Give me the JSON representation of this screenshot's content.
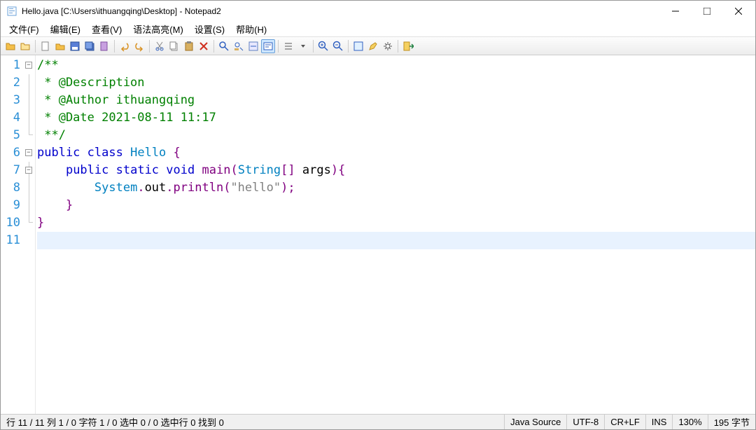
{
  "window": {
    "title": "Hello.java [C:\\Users\\ithuangqing\\Desktop] - Notepad2"
  },
  "menu": {
    "file": "文件(F)",
    "edit": "编辑(E)",
    "view": "查看(V)",
    "syntax": "语法高亮(M)",
    "settings": "设置(S)",
    "help": "帮助(H)"
  },
  "code": {
    "l1": "/**",
    "l2": " * @Description",
    "l3": " * @Author ithuangqing",
    "l4": " * @Date 2021-08-11 11:17",
    "l5": " **/",
    "l6_kw1": "public",
    "l6_kw2": "class",
    "l6_name": "Hello",
    "l7_kw1": "public",
    "l7_kw2": "static",
    "l7_kw3": "void",
    "l7_main": "main",
    "l7_type": "String",
    "l7_args": "args",
    "l8_sys": "System",
    "l8_out": "out",
    "l8_pln": "println",
    "l8_str": "\"hello\""
  },
  "linenums": {
    "n1": "1",
    "n2": "2",
    "n3": "3",
    "n4": "4",
    "n5": "5",
    "n6": "6",
    "n7": "7",
    "n8": "8",
    "n9": "9",
    "n10": "10",
    "n11": "11"
  },
  "status": {
    "pos": "行 11 / 11  列 1 / 0  字符 1 / 0  选中 0 / 0  选中行 0  找到 0",
    "lang": "Java Source",
    "enc": "UTF-8",
    "eol": "CR+LF",
    "ins": "INS",
    "zoom": "130%",
    "size": "195 字节"
  }
}
